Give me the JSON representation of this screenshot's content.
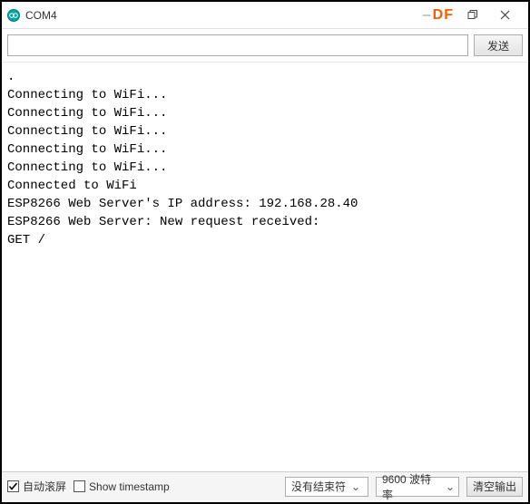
{
  "window": {
    "title": "COM4",
    "df_label": "DF"
  },
  "toolbar": {
    "input_value": "",
    "send_label": "发送"
  },
  "console": {
    "lines": [
      ".",
      "Connecting to WiFi...",
      "Connecting to WiFi...",
      "Connecting to WiFi...",
      "Connecting to WiFi...",
      "Connecting to WiFi...",
      "Connected to WiFi",
      "ESP8266 Web Server's IP address: 192.168.28.40",
      "ESP8266 Web Server: New request received:",
      "GET /"
    ]
  },
  "bottom": {
    "autoscroll_label": "自动滚屏",
    "autoscroll_checked": true,
    "timestamp_label": "Show timestamp",
    "timestamp_checked": false,
    "line_ending_label": "没有结束符",
    "baud_label": "9600 波特率",
    "clear_label": "清空输出"
  }
}
